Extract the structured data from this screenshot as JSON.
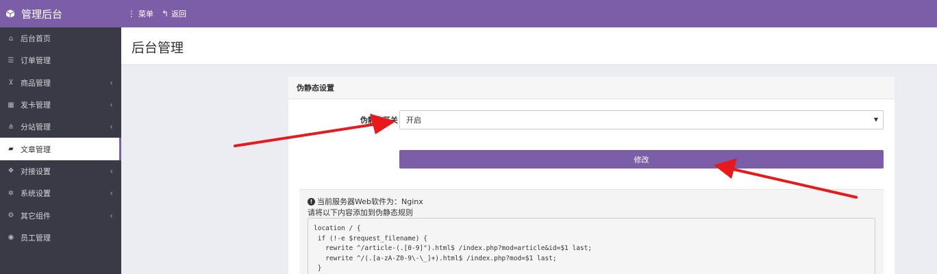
{
  "app": {
    "title": "管理后台"
  },
  "topnav": {
    "menu_label": "菜单",
    "back_label": "返回"
  },
  "sidebar": {
    "items": [
      {
        "label": "后台首页",
        "icon": "home-icon",
        "glyph": "⌂",
        "has_submenu": false,
        "active": false
      },
      {
        "label": "订单管理",
        "icon": "list-icon",
        "glyph": "☰",
        "has_submenu": false,
        "active": false
      },
      {
        "label": "商品管理",
        "icon": "cart-icon",
        "glyph": "⊻",
        "has_submenu": true,
        "active": false
      },
      {
        "label": "发卡管理",
        "icon": "grid-icon",
        "glyph": "▦",
        "has_submenu": true,
        "active": false
      },
      {
        "label": "分站管理",
        "icon": "sitemap-icon",
        "glyph": "⋔",
        "has_submenu": true,
        "active": false
      },
      {
        "label": "文章管理",
        "icon": "book-icon",
        "glyph": "▰",
        "has_submenu": false,
        "active": true
      },
      {
        "label": "对接设置",
        "icon": "cubes-icon",
        "glyph": "❖",
        "has_submenu": true,
        "active": false
      },
      {
        "label": "系统设置",
        "icon": "gear-icon",
        "glyph": "✲",
        "has_submenu": true,
        "active": false
      },
      {
        "label": "其它组件",
        "icon": "gears-icon",
        "glyph": "⚙",
        "has_submenu": true,
        "active": false
      },
      {
        "label": "员工管理",
        "icon": "user-icon",
        "glyph": "◉",
        "has_submenu": false,
        "active": false
      }
    ]
  },
  "page": {
    "title": "后台管理"
  },
  "panel": {
    "heading": "伪静态设置",
    "switch_label": "伪静态开关",
    "switch_value": "开启",
    "submit_label": "修改",
    "info_line1": "当前服务器Web软件为：Nginx",
    "info_line2": "请将以下内容添加到伪静态规则",
    "code": "location / {\n if (!-e $request_filename) {\n   rewrite ^/article-(.[0-9]\").html$ /index.php?mod=article&id=$1 last;\n   rewrite ^/(.[a-zA-Z0-9\\-\\_]+).html$ /index.php?mod=$1 last;\n }"
  },
  "colors": {
    "accent": "#7b5ea7",
    "sidebar_bg": "#3a3a46",
    "arrow": "#e8181b"
  }
}
